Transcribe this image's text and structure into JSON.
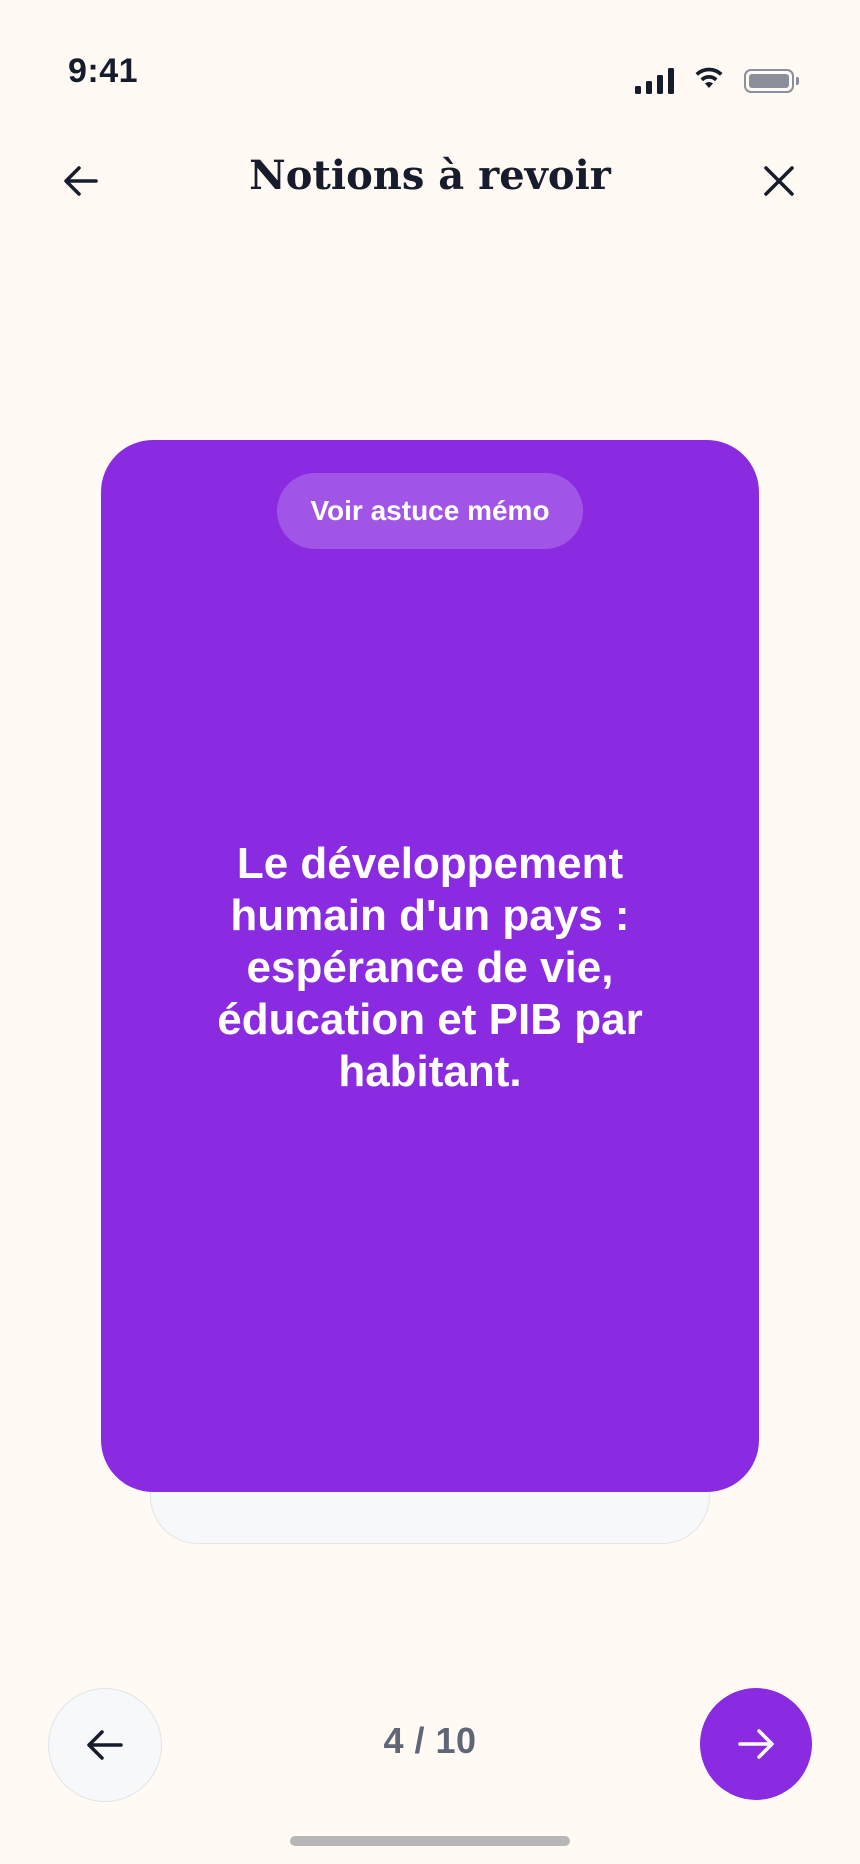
{
  "status_bar": {
    "time": "9:41",
    "icons": [
      "cellular-signal-icon",
      "wifi-icon",
      "battery-icon"
    ]
  },
  "header": {
    "title": "Notions à revoir",
    "back_icon": "arrow-left-icon",
    "close_icon": "close-icon"
  },
  "card": {
    "hint_label": "Voir astuce mémo",
    "text": "Le développement humain d'un pays : espérance de vie, éducation et PIB par habitant.",
    "color": "#8a2be2"
  },
  "navigation": {
    "current": 4,
    "total": 10,
    "counter_text": "4 / 10",
    "prev_icon": "arrow-left-icon",
    "next_icon": "arrow-right-icon"
  },
  "colors": {
    "background": "#fffbf4",
    "accent": "#8a2be2",
    "text": "#161c2b"
  }
}
